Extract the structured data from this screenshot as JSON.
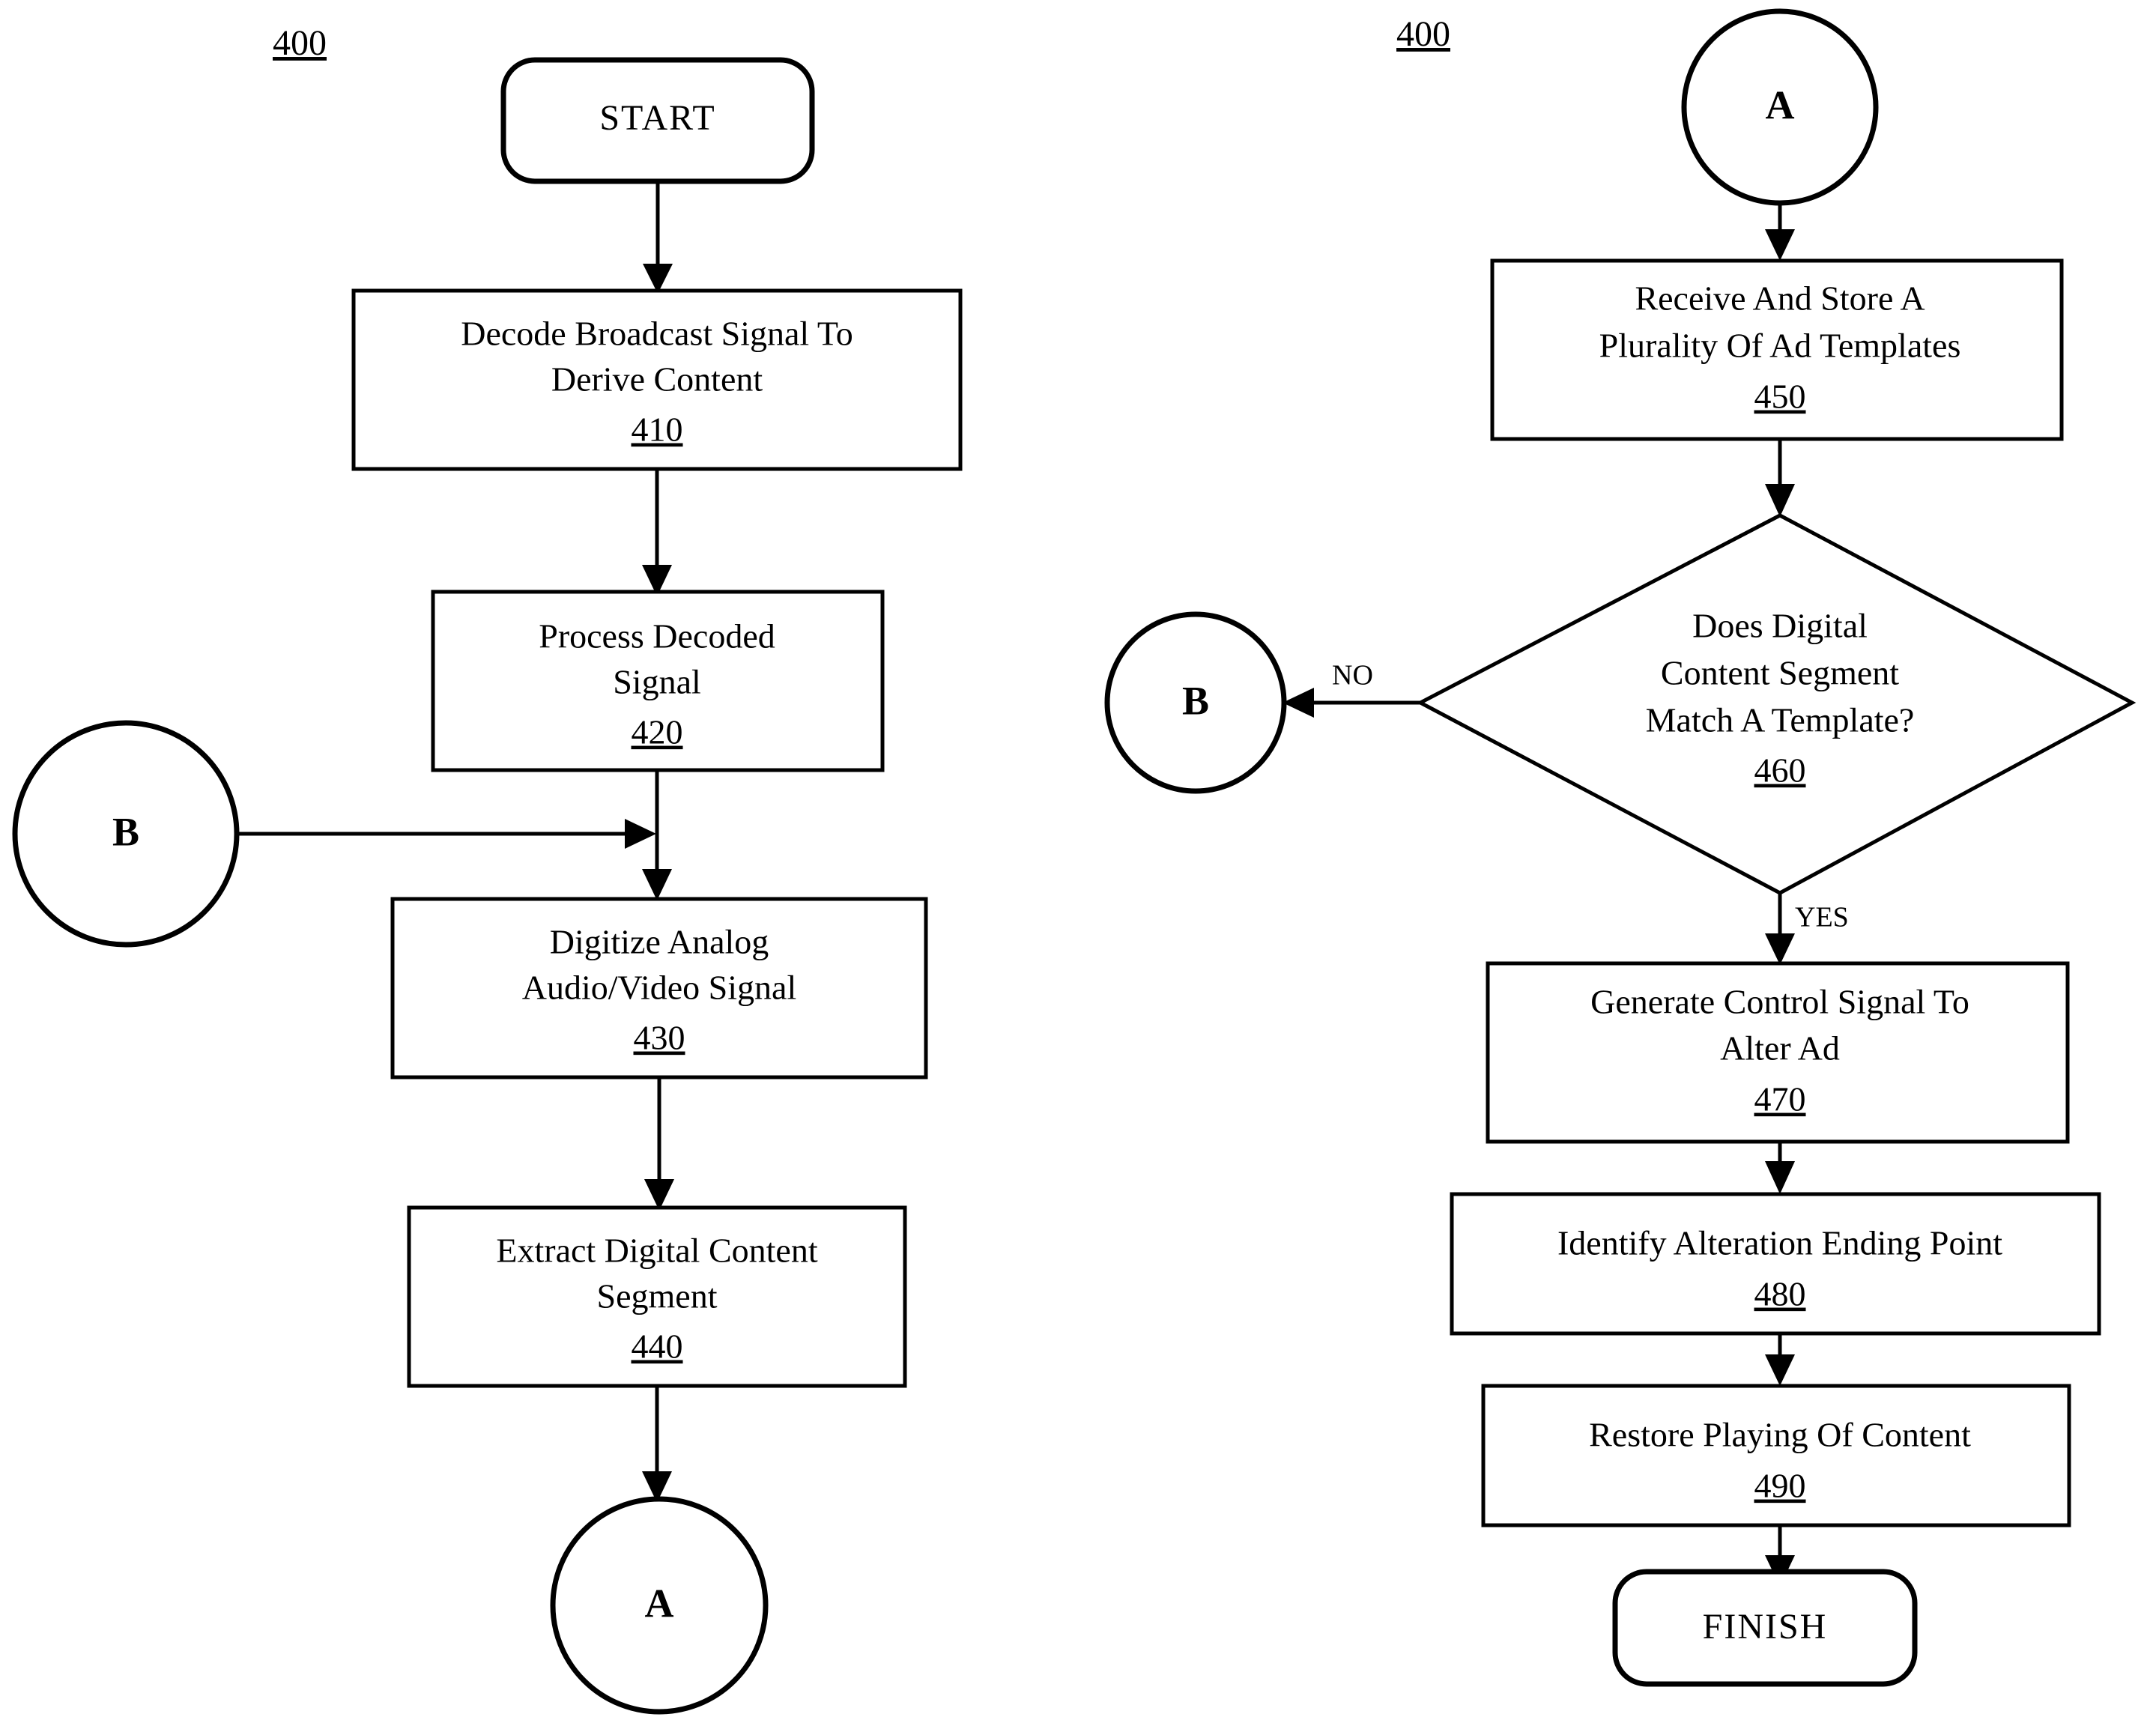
{
  "figure": {
    "label_left": "400",
    "label_right": "400"
  },
  "left_column": {
    "start": {
      "label": "START"
    },
    "step_410": {
      "line1": "Decode Broadcast Signal To",
      "line2": "Derive Content",
      "ref": "410"
    },
    "step_420": {
      "line1": "Process Decoded",
      "line2": "Signal",
      "ref": "420"
    },
    "connector_b": {
      "letter": "B"
    },
    "step_430": {
      "line1": "Digitize Analog",
      "line2": "Audio/Video Signal",
      "ref": "430"
    },
    "step_440": {
      "line1": "Extract Digital Content",
      "line2": "Segment",
      "ref": "440"
    },
    "connector_a": {
      "letter": "A"
    }
  },
  "right_column": {
    "connector_a": {
      "letter": "A"
    },
    "step_450": {
      "line1": "Receive And Store A",
      "line2": "Plurality Of Ad Templates",
      "ref": "450"
    },
    "decision_460": {
      "line1": "Does Digital",
      "line2": "Content Segment",
      "line3": "Match A Template?",
      "ref": "460"
    },
    "branch_no": {
      "label": "NO"
    },
    "branch_yes": {
      "label": "YES"
    },
    "connector_b": {
      "letter": "B"
    },
    "step_470": {
      "line1": "Generate Control Signal To",
      "line2": "Alter Ad",
      "ref": "470"
    },
    "step_480": {
      "line1": "Identify Alteration Ending Point",
      "ref": "480"
    },
    "step_490": {
      "line1": "Restore Playing Of Content",
      "ref": "490"
    },
    "finish": {
      "label": "FINISH"
    }
  },
  "colors": {
    "stroke": "#000000",
    "fill": "#ffffff"
  }
}
